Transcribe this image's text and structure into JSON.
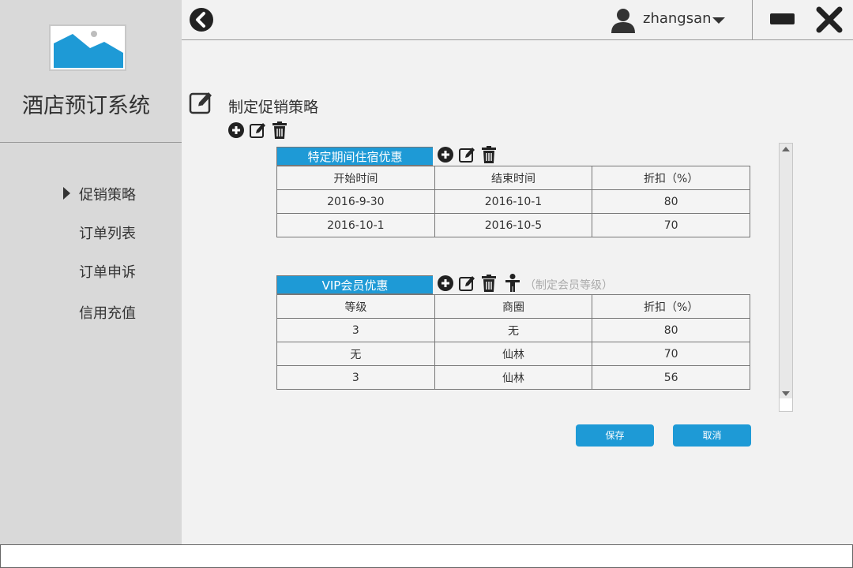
{
  "app": {
    "title": "酒店预订系统"
  },
  "sidebar": {
    "items": [
      {
        "label": "促销策略",
        "active": true
      },
      {
        "label": "订单列表"
      },
      {
        "label": "订单申诉"
      },
      {
        "label": "信用充值"
      }
    ]
  },
  "header": {
    "username": "zhangsan"
  },
  "main": {
    "section_title": "制定促销策略",
    "period_table": {
      "title": "特定期间住宿优惠",
      "headers": [
        "开始时间",
        "结束时间",
        "折扣（%）"
      ],
      "rows": [
        [
          "2016-9-30",
          "2016-10-1",
          "80"
        ],
        [
          "2016-10-1",
          "2016-10-5",
          "70"
        ]
      ]
    },
    "vip_table": {
      "title": "VIP会员优惠",
      "hint": "（制定会员等级）",
      "headers": [
        "等级",
        "商圈",
        "折扣（%）"
      ],
      "rows": [
        [
          "3",
          "无",
          "80"
        ],
        [
          "无",
          "仙林",
          "70"
        ],
        [
          "3",
          "仙林",
          "56"
        ]
      ]
    },
    "save_label": "保存",
    "cancel_label": "取消"
  },
  "colors": {
    "accent": "#1e9ad6",
    "sidebar": "#d9d9d9",
    "background": "#f2f2f2"
  }
}
